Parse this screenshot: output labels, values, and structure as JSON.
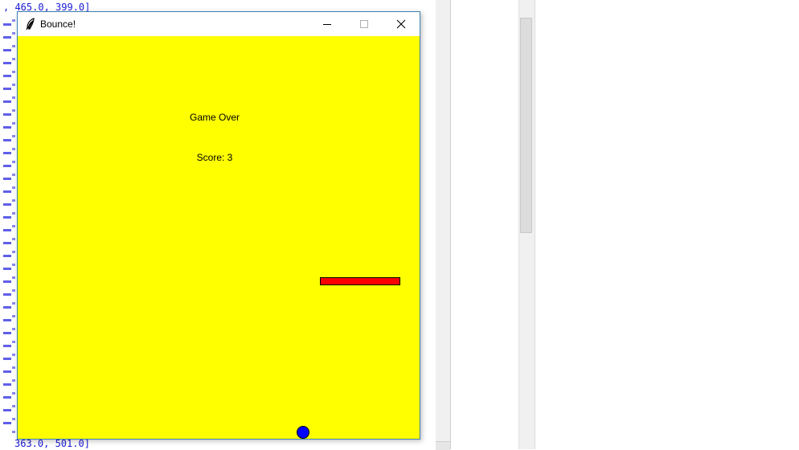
{
  "console": {
    "top_line": ", 465.0, 399.0]",
    "bottom_line": "363.0, 501.0]"
  },
  "window": {
    "title": "Bounce!",
    "icon": "feather-icon",
    "controls": {
      "minimize": "minimize-icon",
      "maximize": "maximize-icon",
      "close": "close-icon"
    }
  },
  "game": {
    "status_text": "Game Over",
    "score_text": "Score: 3",
    "colors": {
      "background": "#ffff00",
      "paddle": "#ff0000",
      "ball": "#0000ff"
    }
  }
}
